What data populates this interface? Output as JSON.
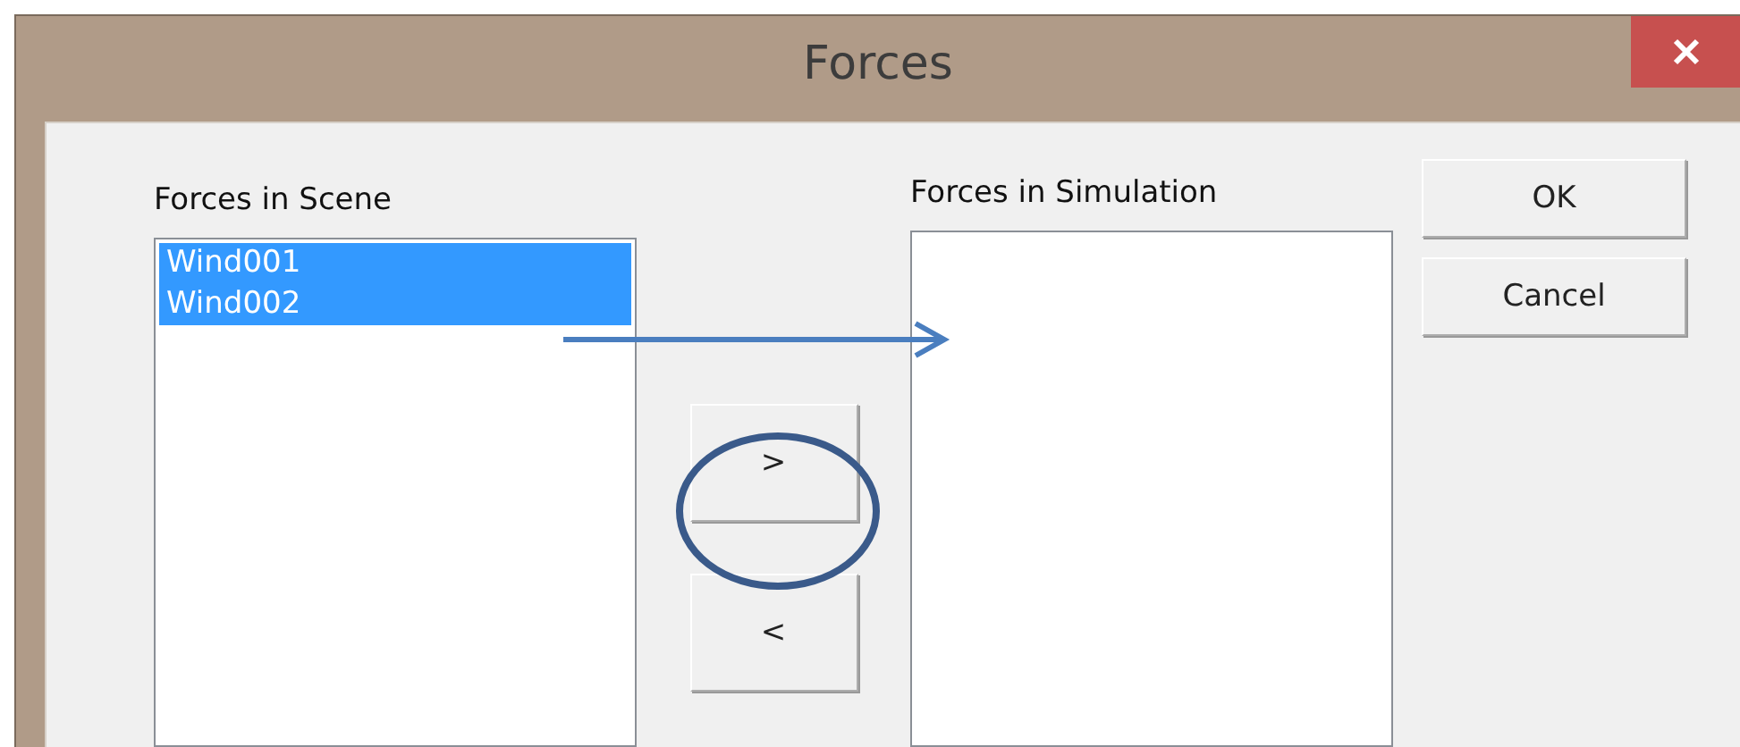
{
  "window": {
    "title": "Forces"
  },
  "scene_list": {
    "label": "Forces in Scene",
    "items": [
      {
        "label": "Wind001",
        "selected": true
      },
      {
        "label": "Wind002",
        "selected": true
      }
    ]
  },
  "move_buttons": [
    ">",
    "<"
  ],
  "simulation_list": {
    "label": "Forces in Simulation"
  },
  "dialog_buttons": [
    "OK",
    "Cancel"
  ]
}
